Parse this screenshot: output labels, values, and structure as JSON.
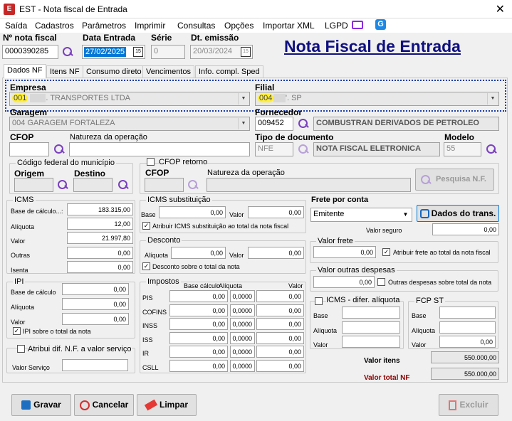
{
  "window": {
    "title": "EST - Nota fiscal de Entrada",
    "app_icon": "E",
    "close": "✕"
  },
  "menu": [
    "Saída",
    "Cadastros",
    "Parâmetros",
    "Imprimir",
    "Consultas",
    "Opções",
    "Importar XML",
    "LGPD"
  ],
  "header": {
    "nota_label": "Nº nota fiscal",
    "nota_value": "0000390285",
    "data_entrada_label": "Data Entrada",
    "data_entrada_value": "27/02/2025",
    "serie_label": "Série",
    "serie_value": "0",
    "dt_emissao_label": "Dt. emissão",
    "dt_emissao_value": "20/03/2024",
    "page_title": "Nota Fiscal de Entrada",
    "calendar_glyph": "15"
  },
  "tabs": [
    "Dados NF",
    "Itens NF",
    "Consumo direto",
    "Vencimentos",
    "Info. compl. Sped"
  ],
  "empresa": {
    "label": "Empresa",
    "code": "001",
    "name": ". TRANSPORTES LTDA"
  },
  "filial": {
    "label": "Filial",
    "code": "004",
    "name": "'. SP"
  },
  "garagem": {
    "label": "Garagem",
    "value": "004 GARAGEM FORTALEZA"
  },
  "fornecedor": {
    "label": "Fornecedor",
    "code": "009452",
    "name": "COMBUSTRAN DERIVADOS DE PETROLEO"
  },
  "cfop": {
    "label": "CFOP",
    "natureza_label": "Natureza da operação"
  },
  "tipo_doc": {
    "label": "Tipo de documento",
    "code": "NFE",
    "name": "NOTA FISCAL ELETRONICA"
  },
  "modelo": {
    "label": "Modelo",
    "value": "55"
  },
  "municipio": {
    "title": "Código federal do município",
    "origem": "Origem",
    "destino": "Destino"
  },
  "cfop_retorno": {
    "title": "CFOP retorno",
    "cfop": "CFOP",
    "natureza": "Natureza da operação",
    "pesquisa": "Pesquisa N.F."
  },
  "icms": {
    "title": "ICMS",
    "base_label": "Base de cálculo...:",
    "base": "183.315,00",
    "aliq_label": "Alíquota",
    "aliq": "12,00",
    "valor_label": "Valor",
    "valor": "21.997,80",
    "outras_label": "Outras",
    "outras": "0,00",
    "isenta_label": "Isenta",
    "isenta": "0,00"
  },
  "icms_st": {
    "title": "ICMS substituição",
    "base_label": "Base",
    "base": "0,00",
    "valor_label": "Valor",
    "valor": "0,00",
    "chk_label": "Atribuir ICMS substituição ao total da nota fiscal"
  },
  "desconto": {
    "title": "Desconto",
    "aliq_label": "Alíquota",
    "aliq": "0,00",
    "valor_label": "Valor",
    "valor": "0,00",
    "chk_label": "Desconto sobre o total da nota"
  },
  "ipi": {
    "title": "IPI",
    "base_label": "Base de cálculo",
    "base": "0,00",
    "aliq_label": "Alíquota",
    "aliq": "0,00",
    "valor_label": "Valor",
    "valor": "0,00",
    "chk_label": "IPI sobre o total da nota"
  },
  "dif_nf": {
    "chk_label": "Atribui dif. N.F. a valor serviço",
    "valor_label": "Valor Serviço",
    "valor": ""
  },
  "impostos": {
    "title": "Impostos",
    "col_base": "Base cálculo",
    "col_aliq": "Alíquota",
    "col_valor": "Valor",
    "rows": [
      {
        "label": "PIS",
        "base": "0,00",
        "aliq": "0,0000",
        "valor": "0,00"
      },
      {
        "label": "COFINS",
        "base": "0,00",
        "aliq": "0,0000",
        "valor": "0,00"
      },
      {
        "label": "INSS",
        "base": "0,00",
        "aliq": "0,0000",
        "valor": "0,00"
      },
      {
        "label": "ISS",
        "base": "0,00",
        "aliq": "0,0000",
        "valor": "0,00"
      },
      {
        "label": "IR",
        "base": "0,00",
        "aliq": "0,0000",
        "valor": "0,00"
      },
      {
        "label": "CSLL",
        "base": "0,00",
        "aliq": "0,0000",
        "valor": "0,00"
      }
    ]
  },
  "frete": {
    "title": "Frete por conta",
    "value": "Emitente",
    "dados_btn": "Dados do trans.",
    "seguro_label": "Valor seguro",
    "seguro": "0,00",
    "valor_frete_title": "Valor frete",
    "valor_frete": "0,00",
    "chk_label": "Atribuir frete ao total da nota fiscal"
  },
  "outras": {
    "title": "Valor outras despesas",
    "valor": "0,00",
    "chk_label": "Outras despesas sobre total da nota"
  },
  "icms_dif": {
    "title": "ICMS - difer. alíquota",
    "base": "Base",
    "aliq": "Alíquota",
    "valor": "Valor"
  },
  "fcp": {
    "title": "FCP ST",
    "base": "Base",
    "aliq": "Alíquota",
    "valor": "Valor",
    "valor_v": "0,00"
  },
  "totais": {
    "itens_label": "Valor itens",
    "itens": "550.000,00",
    "total_label": "Valor total NF",
    "total": "550.000,00"
  },
  "buttons": {
    "gravar": "Gravar",
    "cancelar": "Cancelar",
    "limpar": "Limpar",
    "excluir": "Excluir"
  }
}
